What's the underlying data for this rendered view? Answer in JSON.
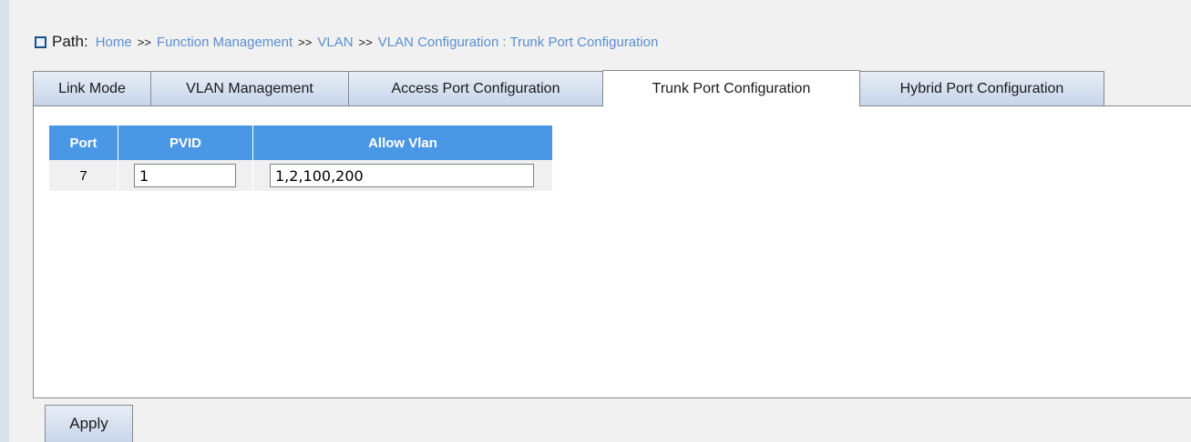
{
  "path": {
    "label": "Path:",
    "crumbs": [
      "Home",
      "Function Management",
      "VLAN",
      "VLAN Configuration",
      "Trunk Port Configuration"
    ],
    "separator": ">>",
    "last_separator": ":"
  },
  "tabs": [
    {
      "label": "Link Mode",
      "active": false
    },
    {
      "label": "VLAN Management",
      "active": false
    },
    {
      "label": "Access Port Configuration",
      "active": false
    },
    {
      "label": "Trunk Port Configuration",
      "active": true
    },
    {
      "label": "Hybrid Port Configuration",
      "active": false
    }
  ],
  "table": {
    "headers": {
      "port": "Port",
      "pvid": "PVID",
      "allow_vlan": "Allow Vlan"
    },
    "rows": [
      {
        "port": "7",
        "pvid": "1",
        "allow_vlan": "1,2,100,200"
      }
    ]
  },
  "actions": {
    "apply_label": "Apply"
  },
  "colors": {
    "header_blue": "#4a97e6",
    "link_blue": "#5b8fd0",
    "tab_gradient": "#c6d4ea"
  }
}
